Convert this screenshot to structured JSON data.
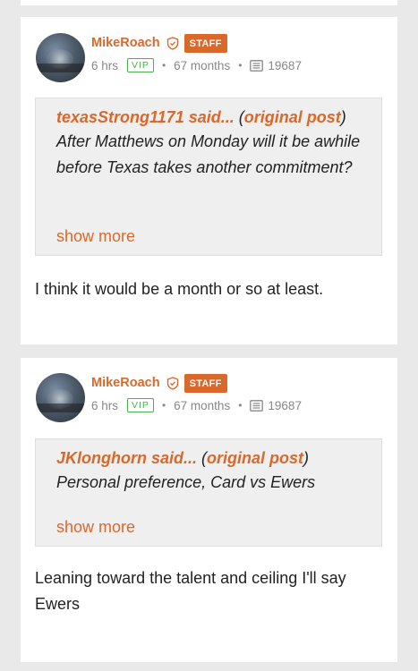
{
  "posts": [
    {
      "username": "MikeRoach",
      "badge": "STAFF",
      "time": "6 hrs",
      "vip": "VIP",
      "tenure": "67 months",
      "post_count": "19687",
      "quote": {
        "author": "texasStrong1171 said...",
        "open_paren": "(",
        "link": "original post",
        "close_paren": ")",
        "text": "After Matthews on Monday will it be awhile before Texas takes another commitment?",
        "show_more": "show more"
      },
      "body": "I think it would be a month or so at least."
    },
    {
      "username": "MikeRoach",
      "badge": "STAFF",
      "time": "6 hrs",
      "vip": "VIP",
      "tenure": "67 months",
      "post_count": "19687",
      "quote": {
        "author": "JKlonghorn said...",
        "open_paren": "(",
        "link": "original post",
        "close_paren": ")",
        "text": "Personal preference, Card vs Ewers",
        "show_more": "show more"
      },
      "body": "Leaning toward the talent and ceiling I'll say Ewers"
    }
  ],
  "colors": {
    "accent": "#d9692b",
    "vip": "#4caf50",
    "page_bg": "#e9e9e9"
  }
}
